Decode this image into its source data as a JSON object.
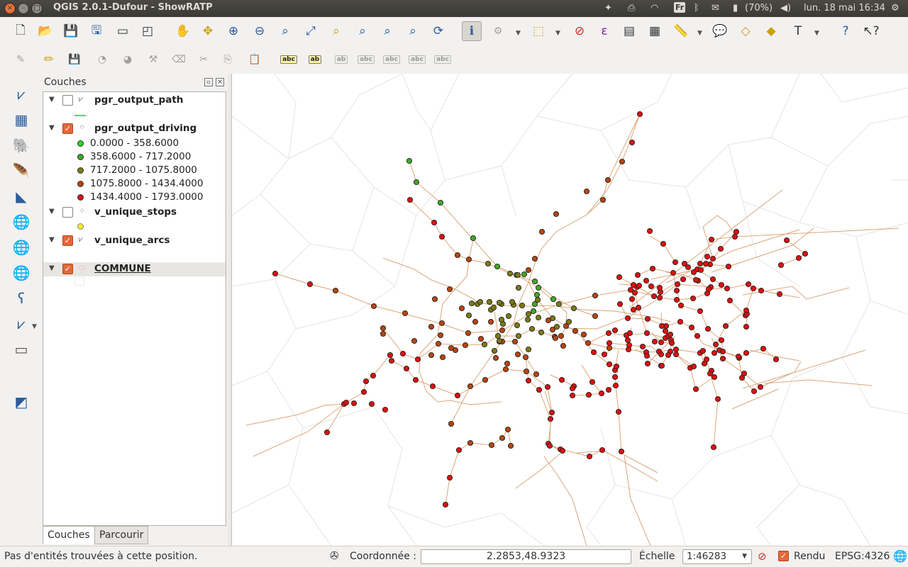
{
  "window": {
    "title": "QGIS 2.0.1-Dufour - ShowRATP",
    "close_glyph": "×",
    "min_glyph": "–",
    "max_glyph": "□"
  },
  "tray": {
    "keyboard_layout": "Fr",
    "battery": "(70%)",
    "clock": "lun. 18 mai 16:34"
  },
  "layers_panel": {
    "title": "Couches",
    "layers": [
      {
        "name": "pgr_output_path",
        "checked": false,
        "symbol_color": "#33ee33"
      },
      {
        "name": "pgr_output_driving",
        "checked": true,
        "legend": [
          {
            "label": "0.0000 - 358.6000",
            "color": "#22dd22"
          },
          {
            "label": "358.6000 - 717.2000",
            "color": "#3fa82a"
          },
          {
            "label": "717.2000 - 1075.8000",
            "color": "#7a7a14"
          },
          {
            "label": "1075.8000 - 1434.4000",
            "color": "#b8440f"
          },
          {
            "label": "1434.4000 - 1793.0000",
            "color": "#e01010"
          }
        ]
      },
      {
        "name": "v_unique_stops",
        "checked": false,
        "symbol_color": "#f3ef22"
      },
      {
        "name": "v_unique_arcs",
        "checked": true
      },
      {
        "name": "COMMUNE",
        "checked": true,
        "current": true
      }
    ],
    "tabs": [
      "Couches",
      "Parcourir"
    ]
  },
  "status": {
    "message": "Pas d'entités trouvées à cette position.",
    "coord_label": "Coordonnée :",
    "coord_value": "2.2853,48.9323",
    "scale_label": "Échelle",
    "scale_value": "1:46283",
    "render_label": "Rendu",
    "crs": "EPSG:4326"
  },
  "colors": {
    "arc_color": "#d9a77a",
    "commune_border": "#e2e2e2",
    "accent": "#e06a3a"
  }
}
